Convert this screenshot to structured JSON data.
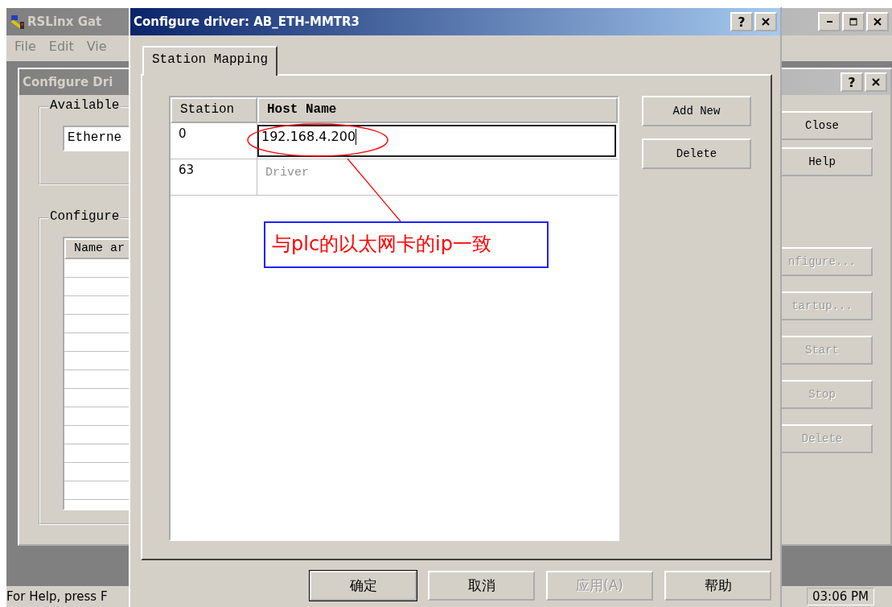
{
  "main_window": {
    "title": "RSLinx Gat",
    "menu": [
      "File",
      "Edit",
      "Vie"
    ],
    "status_text": "For Help, press F",
    "clock": "03:06 PM"
  },
  "configure_drivers_window": {
    "title": "Configure Dri",
    "help_button": "?",
    "available_group": {
      "label": "Available",
      "field_value": "Etherne"
    },
    "configured_group": {
      "label": "Configure",
      "list_header": "Name ar"
    },
    "top_buttons": [
      {
        "label": "Close",
        "disabled": false
      },
      {
        "label": "Help",
        "disabled": false
      }
    ],
    "action_buttons": [
      {
        "label": "nfigure...",
        "disabled": true
      },
      {
        "label": "tartup...",
        "disabled": true
      },
      {
        "label": "Start",
        "disabled": true
      },
      {
        "label": "Stop",
        "disabled": true
      },
      {
        "label": "Delete",
        "disabled": true
      }
    ]
  },
  "dialog": {
    "title": "Configure driver: AB_ETH-MMTR3",
    "help_button": "?",
    "tabs": [
      {
        "label": "Station Mapping",
        "selected": true
      }
    ],
    "table": {
      "columns": [
        "Station",
        "Host Name"
      ],
      "rows": [
        {
          "station": "0",
          "host_name": "192.168.4.200",
          "editing": true,
          "disabled": false
        },
        {
          "station": "63",
          "host_name": "Driver",
          "editing": false,
          "disabled": true
        }
      ]
    },
    "side_buttons": [
      "Add New",
      "Delete"
    ],
    "annotation": "与plc的以太网卡的ip一致",
    "buttons": [
      {
        "label": "确定",
        "default": true,
        "disabled": false
      },
      {
        "label": "取消",
        "default": false,
        "disabled": false
      },
      {
        "label": "应用(A)",
        "default": false,
        "disabled": true
      },
      {
        "label": "帮助",
        "default": false,
        "disabled": false
      }
    ]
  }
}
